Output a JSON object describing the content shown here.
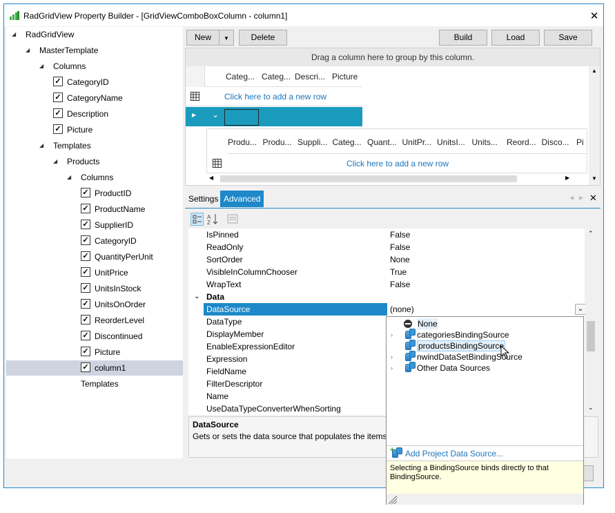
{
  "window": {
    "title": "RadGridView Property Builder - [GridViewComboBoxColumn - column1]"
  },
  "tree": [
    {
      "label": "RadGridView",
      "checkbox": false,
      "arrow": true
    },
    {
      "label": "MasterTemplate",
      "checkbox": false,
      "arrow": true
    },
    {
      "label": "Columns",
      "checkbox": false,
      "arrow": true
    },
    {
      "label": "CategoryID",
      "checkbox": true
    },
    {
      "label": "CategoryName",
      "checkbox": true
    },
    {
      "label": "Description",
      "checkbox": true
    },
    {
      "label": "Picture",
      "checkbox": true
    },
    {
      "label": "Templates",
      "checkbox": false,
      "arrow": true
    },
    {
      "label": "Products",
      "checkbox": false,
      "arrow": true
    },
    {
      "label": "Columns",
      "checkbox": false,
      "arrow": true
    },
    {
      "label": "ProductID",
      "checkbox": true
    },
    {
      "label": "ProductName",
      "checkbox": true
    },
    {
      "label": "SupplierID",
      "checkbox": true
    },
    {
      "label": "CategoryID",
      "checkbox": true
    },
    {
      "label": "QuantityPerUnit",
      "checkbox": true
    },
    {
      "label": "UnitPrice",
      "checkbox": true
    },
    {
      "label": "UnitsInStock",
      "checkbox": true
    },
    {
      "label": "UnitsOnOrder",
      "checkbox": true
    },
    {
      "label": "ReorderLevel",
      "checkbox": true
    },
    {
      "label": "Discontinued",
      "checkbox": true
    },
    {
      "label": "Picture",
      "checkbox": true
    },
    {
      "label": "column1",
      "checkbox": true,
      "selected": true
    },
    {
      "label": "Templates",
      "checkbox": false
    }
  ],
  "toolbar": {
    "new": "New",
    "delete": "Delete",
    "build": "Build",
    "load": "Load",
    "save": "Save"
  },
  "grid": {
    "group_hint": "Drag a column here to group by this column.",
    "headers": [
      "Categ...",
      "Categ...",
      "Descri...",
      "Picture"
    ],
    "add_row": "Click here to add a new row",
    "child_headers": [
      "Produ...",
      "Produ...",
      "Suppli...",
      "Categ...",
      "Quant...",
      "UnitPr...",
      "UnitsI...",
      "Units...",
      "Reord...",
      "Disco...",
      "Pi"
    ],
    "child_add_row": "Click here to add a new row"
  },
  "tabs": {
    "settings": "Settings",
    "advanced": "Advanced"
  },
  "properties": {
    "rows_top": [
      {
        "name": "IsPinned",
        "value": "False"
      },
      {
        "name": "ReadOnly",
        "value": "False"
      },
      {
        "name": "SortOrder",
        "value": "None"
      },
      {
        "name": "VisibleInColumnChooser",
        "value": "True"
      },
      {
        "name": "WrapText",
        "value": "False"
      }
    ],
    "category": "Data",
    "selected": {
      "name": "DataSource",
      "value": "(none)"
    },
    "rows_bottom": [
      {
        "name": "DataType"
      },
      {
        "name": "DisplayMember"
      },
      {
        "name": "EnableExpressionEditor"
      },
      {
        "name": "Expression"
      },
      {
        "name": "FieldName"
      },
      {
        "name": "FilterDescriptor"
      },
      {
        "name": "Name"
      },
      {
        "name": "UseDataTypeConverterWhenSorting"
      }
    ]
  },
  "help": {
    "title": "DataSource",
    "text": "Gets or sets the data source that populates the items fo"
  },
  "dropdown": {
    "items": [
      {
        "label": "None",
        "kind": "none"
      },
      {
        "label": "categoriesBindingSource",
        "kind": "db",
        "expand": true
      },
      {
        "label": "productsBindingSource",
        "kind": "db",
        "expand": false,
        "hover": true
      },
      {
        "label": "nwindDataSetBindingSource",
        "kind": "db",
        "expand": true
      },
      {
        "label": "Other Data Sources",
        "kind": "db",
        "expand": true
      }
    ],
    "add_project": "Add Project Data Source...",
    "hint": "Selecting a BindingSource binds directly to that BindingSource."
  }
}
